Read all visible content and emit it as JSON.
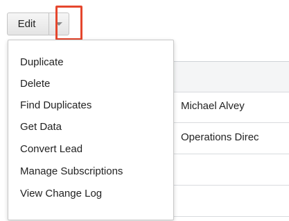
{
  "toolbar": {
    "edit_label": "Edit",
    "caret_icon": "chevron-down-icon",
    "highlight_color": "#e5462d"
  },
  "menu": {
    "items": [
      {
        "label": "Duplicate"
      },
      {
        "label": "Delete"
      },
      {
        "label": "Find Duplicates"
      },
      {
        "label": "Get Data"
      },
      {
        "label": "Convert Lead"
      },
      {
        "label": "Manage Subscriptions"
      },
      {
        "label": "View Change Log"
      }
    ]
  },
  "record": {
    "name_value": "Michael Alvey",
    "title_value": "Operations Direc"
  }
}
